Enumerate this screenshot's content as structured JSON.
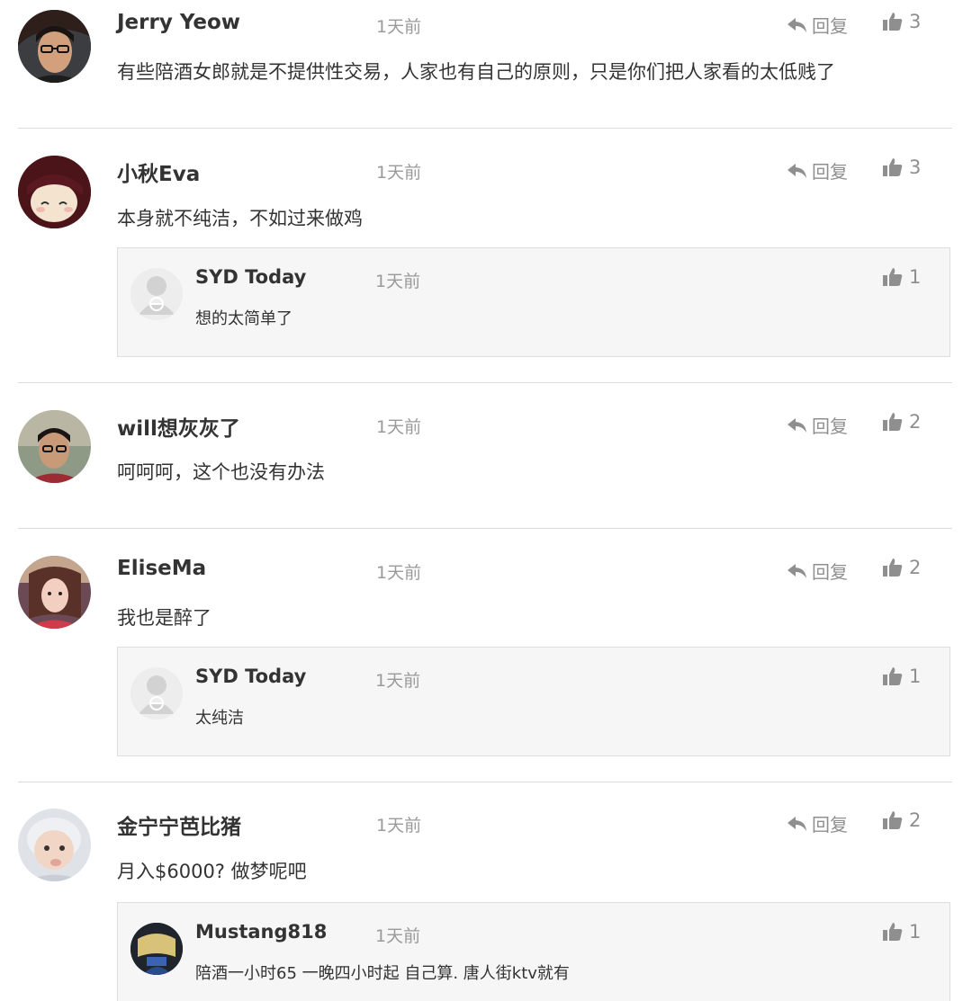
{
  "labels": {
    "reply": "回复"
  },
  "comments": [
    {
      "username": "Jerry Yeow",
      "time": "1天前",
      "likes": "3",
      "text": "有些陪酒女郎就是不提供性交易，人家也有自己的原则，只是你们把人家看的太低贱了",
      "replies": []
    },
    {
      "username": "小秋Eva",
      "time": "1天前",
      "likes": "3",
      "text": "本身就不纯洁，不如过来做鸡",
      "replies": [
        {
          "username": "SYD Today",
          "time": "1天前",
          "likes": "1",
          "text": "想的太简单了"
        }
      ]
    },
    {
      "username": "will想灰灰了",
      "time": "1天前",
      "likes": "2",
      "text": "呵呵呵，这个也没有办法",
      "replies": []
    },
    {
      "username": "EliseMa",
      "time": "1天前",
      "likes": "2",
      "text": "我也是醉了",
      "replies": [
        {
          "username": "SYD Today",
          "time": "1天前",
          "likes": "1",
          "text": "太纯洁"
        }
      ]
    },
    {
      "username": "金宁宁芭比猪",
      "time": "1天前",
      "likes": "2",
      "text": "月入$6000? 做梦呢吧",
      "replies": [
        {
          "username": "Mustang818",
          "time": "1天前",
          "likes": "1",
          "text": "陪酒一小时65 一晚四小时起 自己算. 唐人街ktv就有"
        }
      ]
    }
  ],
  "icons": {
    "reply": "reply-arrow-icon",
    "like": "thumbs-up-icon",
    "default_avatar": "default-user-avatar-icon"
  },
  "colors": {
    "meta_text": "#9a9a9a",
    "action_icon": "#8f8f8f",
    "reply_box_bg": "#f6f6f6",
    "divider": "#dcdcdc"
  }
}
